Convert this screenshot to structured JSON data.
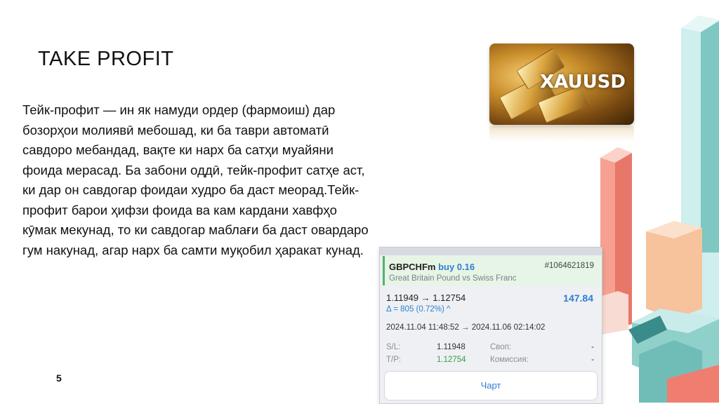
{
  "slide": {
    "title": "TAKE PROFIT",
    "body": "Тейк-профит — ин як намуди ордер (фармоиш) дар бозорҳои молиявӣ мебошад, ки ба таври автоматӣ савдоро мебандад, вақте ки нарх ба сатҳи муайяни фоида мерасад. Ба забони оддӣ, тейк-профит сатҳе аст, ки дар он савдогар фоидаи худро ба даст меорад.Тейк-профит барои ҳифзи фоида ва кам кардани хавфҳо кӯмак мекунад, то ки савдогар маблағи ба даст овардаро гум накунад, агар нарх ба самти муқобил ҳаракат кунад.",
    "page_number": "5"
  },
  "gold_card": {
    "label": "XAUUSD"
  },
  "trade": {
    "symbol": "GBPCHFm",
    "side": "buy 0.16",
    "ticket": "#1064621819",
    "description": "Great Britain Pound vs Swiss Franc",
    "price_open": "1.11949",
    "arrow": "→",
    "price_close": "1.12754",
    "profit": "147.84",
    "delta": "Δ = 805 (0.72%) ^",
    "time_open": "2024.11.04 11:48:52",
    "time_close": "2024.11.06 02:14:02",
    "sl_label": "S/L:",
    "sl_value": "1.11948",
    "tp_label": "T/P:",
    "tp_value": "1.12754",
    "swap_label": "Своп:",
    "swap_value": "-",
    "commission_label": "Комиссия:",
    "commission_value": "-",
    "chart_button": "Чарт"
  },
  "colors": {
    "accent_blue": "#2f7fd1",
    "buy_green": "#52b36a",
    "block_teal": "#7fc7c2",
    "block_salmon": "#f08c80"
  }
}
